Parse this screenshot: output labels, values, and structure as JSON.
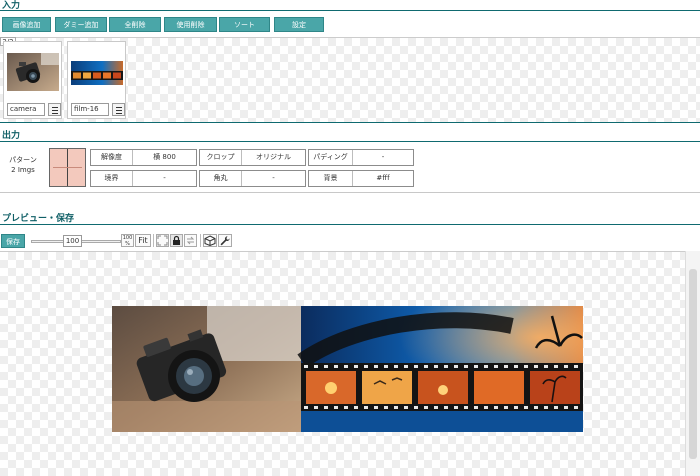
{
  "sections": {
    "input": "入力",
    "output": "出力",
    "preview": "プレビュー・保存"
  },
  "toolbar": [
    "画像追加",
    "ダミー追加",
    "全削除",
    "使用削除",
    "ソート",
    "設定"
  ],
  "input_panel": {
    "counter": "2/2",
    "thumbs": [
      {
        "name": "camera"
      },
      {
        "name": "film-16"
      }
    ]
  },
  "output": {
    "pattern_label": "パターン",
    "pattern_count": "2 Imgs",
    "row1": [
      {
        "label": "解像度",
        "value": "横 800"
      },
      {
        "label": "クロップ",
        "value": "オリジナル"
      },
      {
        "label": "パディング",
        "value": "-"
      }
    ],
    "row2": [
      {
        "label": "境界",
        "value": "-"
      },
      {
        "label": "角丸",
        "value": "-"
      },
      {
        "label": "背景",
        "value": "#fff"
      }
    ]
  },
  "preview": {
    "save_label": "保存",
    "zoom_value": "100",
    "zoom_reset": "100",
    "fit_label": "Fit"
  },
  "colors": {
    "accent": "#4aa6a8",
    "rule": "#0f6a70",
    "title": "#0f5f66"
  }
}
